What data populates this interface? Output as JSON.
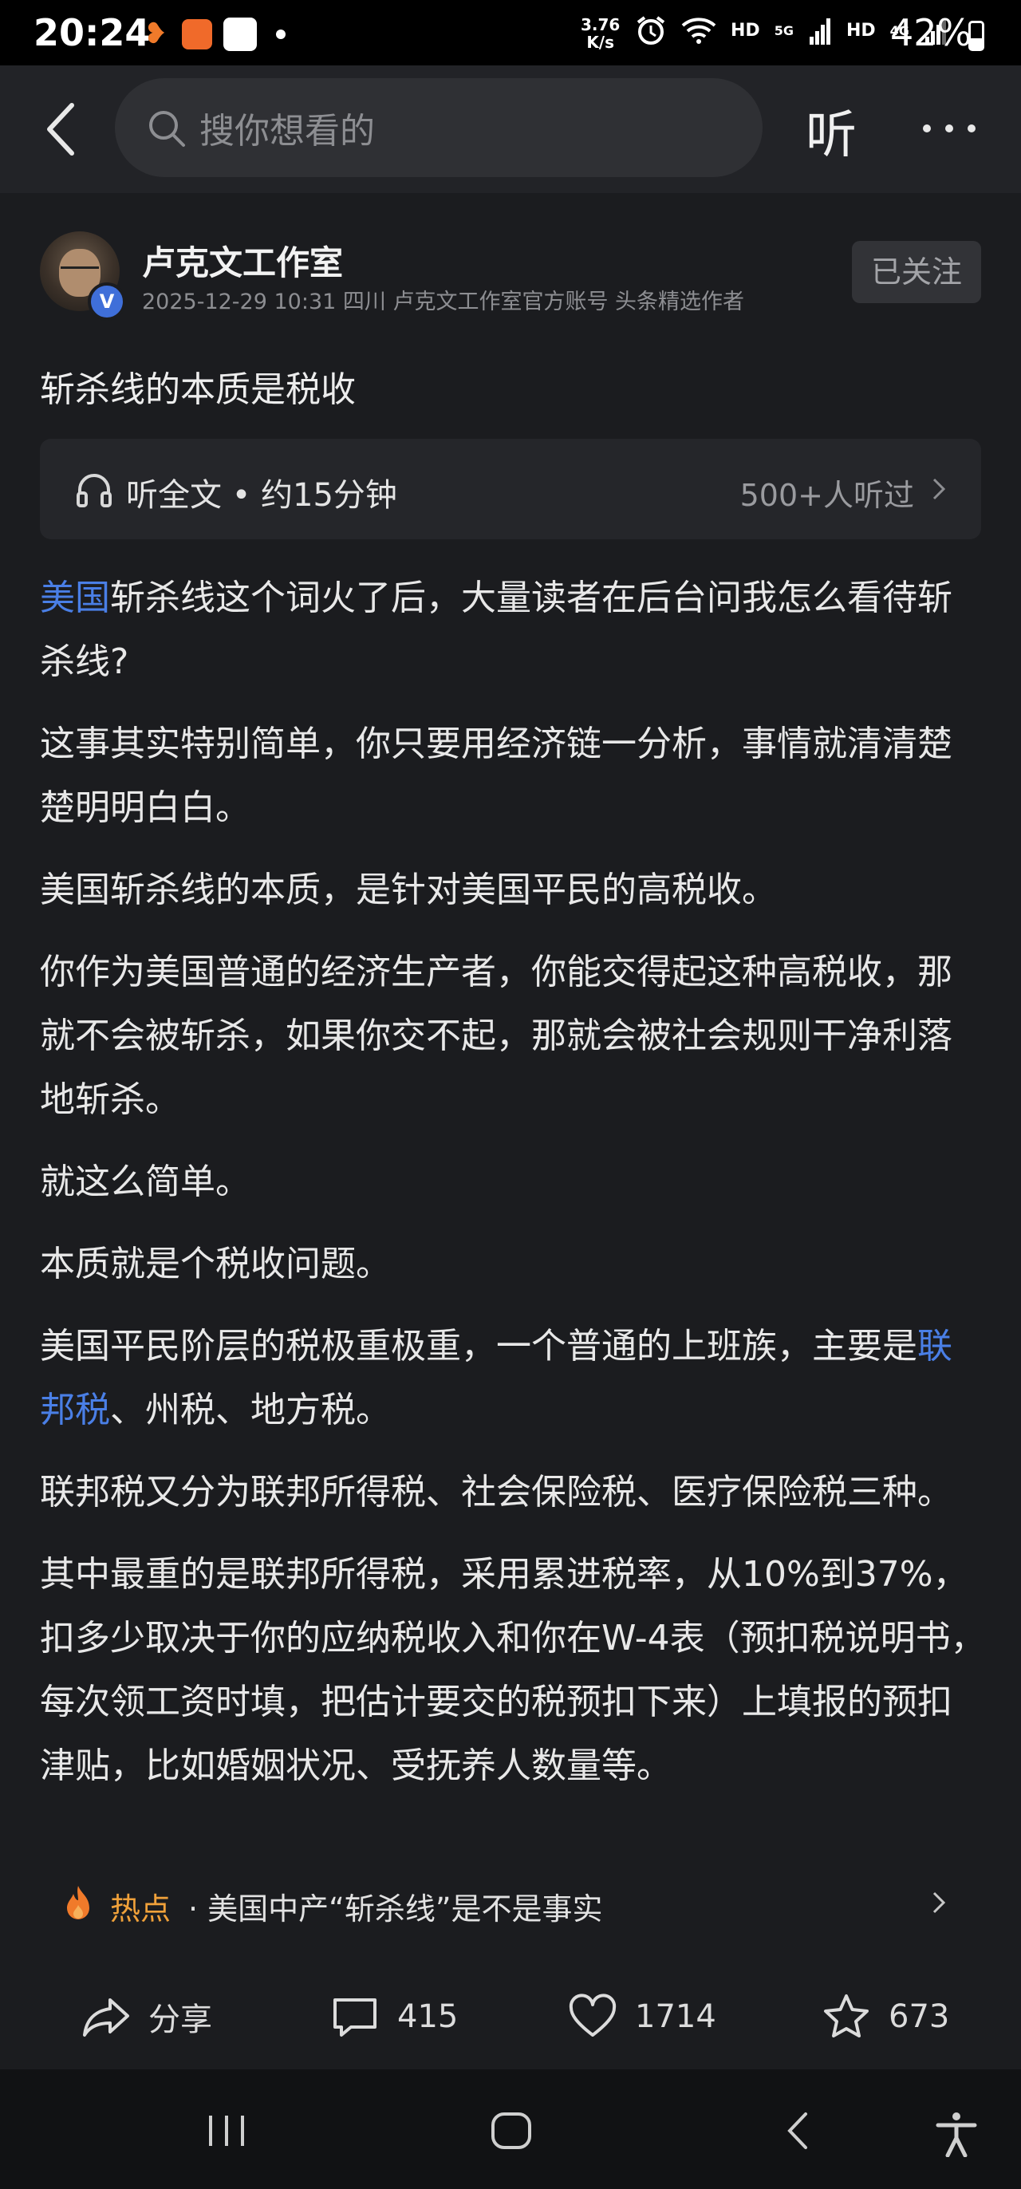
{
  "status_bar": {
    "time": "20:24",
    "net_speed": "3.76",
    "net_unit": "K/s",
    "hd1": "HD",
    "net1": "5G",
    "hd2": "HD",
    "net2": "4G",
    "battery": "42%",
    "icons": [
      "tiktok-lite-icon",
      "gift-app-icon",
      "toutiao-icon",
      "notification-dot",
      "alarm-icon",
      "wifi-icon",
      "signal-icon",
      "battery-icon"
    ]
  },
  "topnav": {
    "search_placeholder": "搜你想看的",
    "listen_label": "听"
  },
  "author": {
    "name": "卢克文工作室",
    "meta": "2025-12-29  10:31  四川  卢克文工作室官方账号 头条精选作者",
    "badge": "V",
    "follow_label": "已关注"
  },
  "article": {
    "title": "斩杀线的本质是税收",
    "listen_card": {
      "label": "听全文 • 约15分钟",
      "count": "500+人听过"
    },
    "p1_link": "美国",
    "p1_rest": "斩杀线这个词火了后，大量读者在后台问我怎么看待斩杀线?",
    "p2": "这事其实特别简单，你只要用经济链一分析，事情就清清楚楚明明白白。",
    "p3": "美国斩杀线的本质，是针对美国平民的高税收。",
    "p4": "你作为美国普通的经济生产者，你能交得起这种高税收，那就不会被斩杀，如果你交不起，那就会被社会规则干净利落地斩杀。",
    "p5": "就这么简单。",
    "p6": "本质就是个税收问题。",
    "p7_start": "美国平民阶层的税极重极重，一个普通的上班族，主要是",
    "p7_link": "联邦税",
    "p7_end": "、州税、地方税。",
    "p8": "联邦税又分为联邦所得税、社会保险税、医疗保险税三种。",
    "p9": "其中最重的是联邦所得税，采用累进税率，从10%到37%，扣多少取决于你的应纳税收入和你在W-4表（预扣税说明书，每次领工资时填，把估计要交的税预扣下来）上填报的预扣津贴，比如婚姻状况、受抚养人数量等。"
  },
  "hot": {
    "label": "热点",
    "text": "· 美国中产“斩杀线”是不是事实"
  },
  "actions": {
    "share": "分享",
    "comments": "415",
    "likes": "1714",
    "favorites": "673"
  },
  "colors": {
    "background": "#1b1c1f",
    "link": "#4a7fe6",
    "hot": "#f0a13a"
  }
}
